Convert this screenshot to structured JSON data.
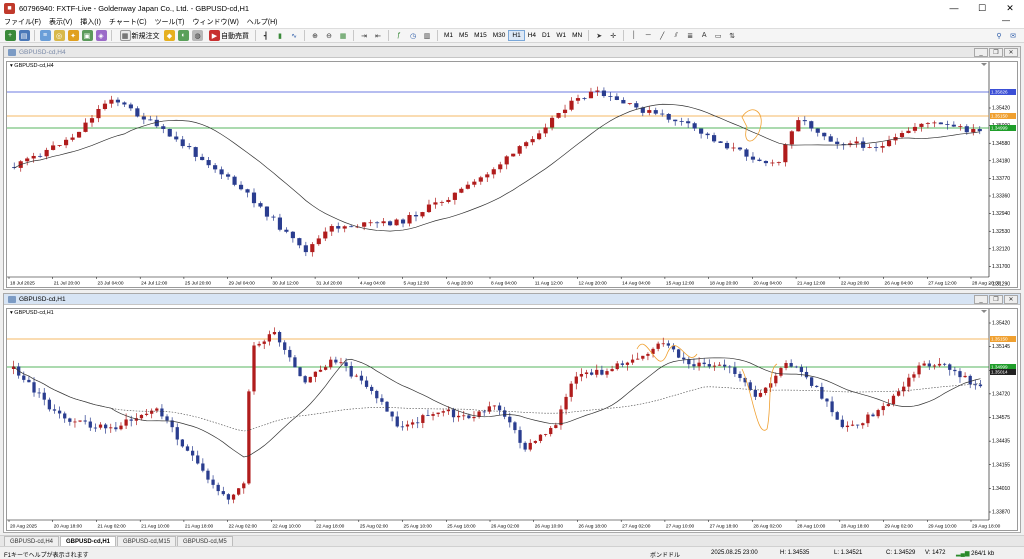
{
  "window": {
    "title": "60796940: FXTF-Live - Goldenway Japan Co., Ltd. - GBPUSD-cd,H1",
    "minimize": "—",
    "maximize": "☐",
    "close": "✕"
  },
  "menu": {
    "items": [
      "ファイル(F)",
      "表示(V)",
      "挿入(I)",
      "チャート(C)",
      "ツール(T)",
      "ウィンドウ(W)",
      "ヘルプ(H)"
    ]
  },
  "toolbar": {
    "new_order_label": "新規注文",
    "auto_trade_label": "自動売買",
    "timeframes": [
      "M1",
      "M5",
      "M15",
      "M30",
      "H1",
      "H4",
      "D1",
      "W1",
      "MN"
    ],
    "active_timeframe": "H1"
  },
  "top_chart": {
    "window_title": "GBPUSD-cd,H4",
    "label": "GBPUSD-cd,H4",
    "price_ticks": [
      "1.35420",
      "1.35000",
      "1.34580",
      "1.34180",
      "1.33770",
      "1.33360",
      "1.32940",
      "1.32530",
      "1.32120",
      "1.31700",
      "1.31290"
    ],
    "tags": [
      {
        "value": "1.35826",
        "color": "#3b4fd6"
      },
      {
        "value": "1.35150",
        "color": "#f0a030"
      },
      {
        "value": "1.34999",
        "color": "#1f9e2a"
      }
    ],
    "time_ticks": [
      "18 Jul 2025",
      "21 Jul 20:00",
      "23 Jul 04:00",
      "24 Jul 12:00",
      "25 Jul 20:00",
      "29 Jul 04:00",
      "30 Jul 12:00",
      "31 Jul 20:00",
      "4 Aug 04:00",
      "5 Aug 12:00",
      "6 Aug 20:00",
      "8 Aug 04:00",
      "11 Aug 12:00",
      "12 Aug 20:00",
      "14 Aug 04:00",
      "15 Aug 12:00",
      "18 Aug 20:00",
      "20 Aug 04:00",
      "21 Aug 12:00",
      "22 Aug 20:00",
      "26 Aug 04:00",
      "27 Aug 12:00",
      "28 Aug 20:00"
    ]
  },
  "bottom_chart": {
    "window_title": "GBPUSD-cd,H1",
    "label": "GBPUSD-cd,H1",
    "price_ticks": [
      "1.35420",
      "1.35145",
      "1.34865",
      "1.34720",
      "1.34575",
      "1.34435",
      "1.34155",
      "1.34010",
      "1.33870"
    ],
    "tags": [
      {
        "value": "1.35150",
        "color": "#f0a030"
      },
      {
        "value": "1.34999",
        "color": "#1f9e2a"
      },
      {
        "value": "1.35014",
        "color": "#222222"
      }
    ],
    "time_ticks": [
      "20 Aug 2025",
      "20 Aug 18:00",
      "21 Aug 02:00",
      "21 Aug 10:00",
      "21 Aug 18:00",
      "22 Aug 02:00",
      "22 Aug 10:00",
      "22 Aug 18:00",
      "25 Aug 02:00",
      "25 Aug 10:00",
      "25 Aug 18:00",
      "26 Aug 02:00",
      "26 Aug 10:00",
      "26 Aug 18:00",
      "27 Aug 02:00",
      "27 Aug 10:00",
      "27 Aug 18:00",
      "28 Aug 02:00",
      "28 Aug 10:00",
      "28 Aug 18:00",
      "29 Aug 02:00",
      "29 Aug 10:00",
      "29 Aug 18:00"
    ]
  },
  "tabs": [
    "GBPUSD-cd,H4",
    "GBPUSD-cd,H1",
    "GBPUSD-cd,M15",
    "GBPUSD-cd,M5"
  ],
  "active_tab": "GBPUSD-cd,H1",
  "status": {
    "help": "F1キーでヘルプが表示されます",
    "profile": "ボンドドル",
    "datetime": "2025.08.25 23:00",
    "high": "H: 1.34535",
    "low": "L: 1.34521",
    "close": "C: 1.34529",
    "volume": "V: 1472",
    "traffic": "264/1 kb"
  },
  "colors": {
    "bull": "#b01c1c",
    "bear": "#2a3d8f",
    "ma_solid": "#333333",
    "line_blue": "#3b4fd6",
    "line_orange": "#f0a030",
    "line_green": "#1f9e2a"
  }
}
